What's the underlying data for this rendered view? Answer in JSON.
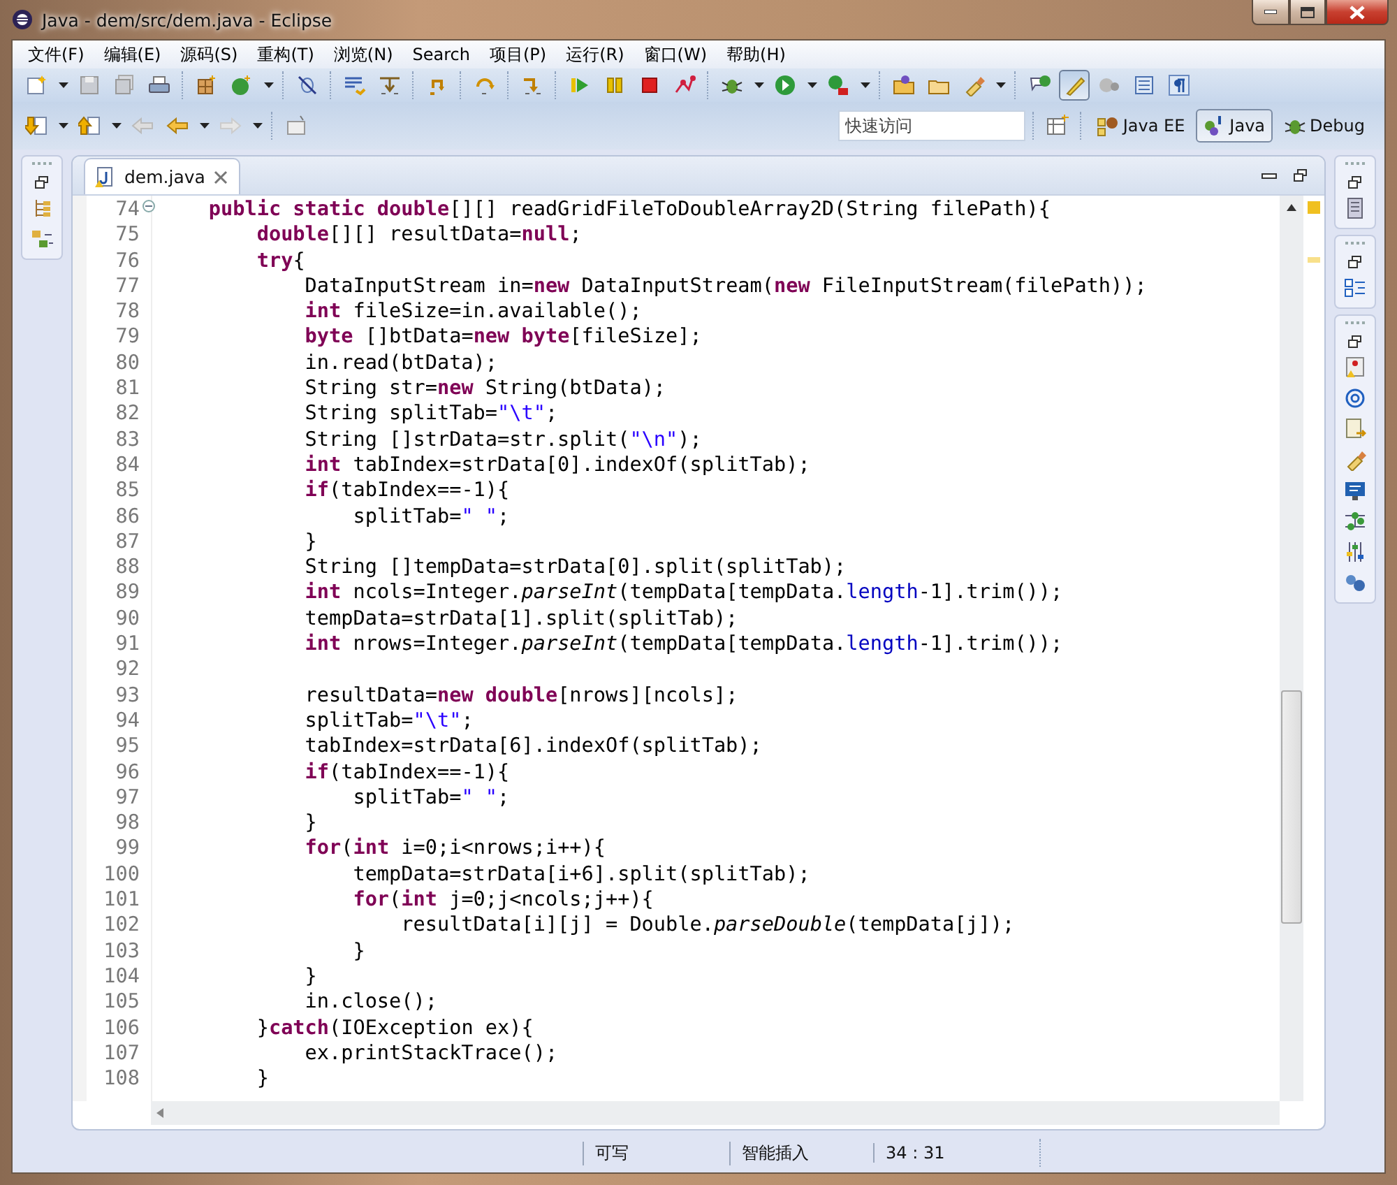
{
  "window": {
    "title": "Java - dem/src/dem.java - Eclipse"
  },
  "menu": [
    "文件(F)",
    "编辑(E)",
    "源码(S)",
    "重构(T)",
    "浏览(N)",
    "Search",
    "项目(P)",
    "运行(R)",
    "窗口(W)",
    "帮助(H)"
  ],
  "toolbar": {
    "mark_occurrences_pressed": true
  },
  "quick_access": {
    "placeholder": "快速访问"
  },
  "perspectives": [
    {
      "label": "Java EE",
      "selected": false
    },
    {
      "label": "Java",
      "selected": true
    },
    {
      "label": "Debug",
      "selected": false
    }
  ],
  "editor_tabs": [
    {
      "label": "dem.java",
      "selected": true
    }
  ],
  "code": {
    "lines": [
      {
        "number": "74",
        "folding": true,
        "tokens": [
          {
            "kind": "keyword",
            "text": "    public static double"
          },
          {
            "kind": "plain",
            "text": "[][] readGridFileToDoubleArray2D(String filePath){"
          }
        ]
      },
      {
        "number": "75",
        "tokens": [
          {
            "kind": "keyword",
            "text": "        double"
          },
          {
            "kind": "plain",
            "text": "[][] resultData="
          },
          {
            "kind": "keyword",
            "text": "null"
          },
          {
            "kind": "plain",
            "text": ";"
          }
        ]
      },
      {
        "number": "76",
        "tokens": [
          {
            "kind": "keyword",
            "text": "        try"
          },
          {
            "kind": "plain",
            "text": "{"
          }
        ]
      },
      {
        "number": "77",
        "tokens": [
          {
            "kind": "plain",
            "text": "            DataInputStream in="
          },
          {
            "kind": "keyword",
            "text": "new"
          },
          {
            "kind": "plain",
            "text": " DataInputStream("
          },
          {
            "kind": "keyword",
            "text": "new"
          },
          {
            "kind": "plain",
            "text": " FileInputStream(filePath));"
          }
        ]
      },
      {
        "number": "78",
        "tokens": [
          {
            "kind": "keyword",
            "text": "            int"
          },
          {
            "kind": "plain",
            "text": " fileSize=in.available();"
          }
        ]
      },
      {
        "number": "79",
        "tokens": [
          {
            "kind": "keyword",
            "text": "            byte"
          },
          {
            "kind": "plain",
            "text": " []btData="
          },
          {
            "kind": "keyword",
            "text": "new byte"
          },
          {
            "kind": "plain",
            "text": "[fileSize];"
          }
        ]
      },
      {
        "number": "80",
        "tokens": [
          {
            "kind": "plain",
            "text": "            in.read(btData);"
          }
        ]
      },
      {
        "number": "81",
        "tokens": [
          {
            "kind": "plain",
            "text": "            String str="
          },
          {
            "kind": "keyword",
            "text": "new"
          },
          {
            "kind": "plain",
            "text": " String(btData);"
          }
        ]
      },
      {
        "number": "82",
        "tokens": [
          {
            "kind": "plain",
            "text": "            String splitTab="
          },
          {
            "kind": "string",
            "text": "\"\\t\""
          },
          {
            "kind": "plain",
            "text": ";"
          }
        ]
      },
      {
        "number": "83",
        "tokens": [
          {
            "kind": "plain",
            "text": "            String []strData=str.split("
          },
          {
            "kind": "string",
            "text": "\"\\n\""
          },
          {
            "kind": "plain",
            "text": ");"
          }
        ]
      },
      {
        "number": "84",
        "tokens": [
          {
            "kind": "keyword",
            "text": "            int"
          },
          {
            "kind": "plain",
            "text": " tabIndex=strData[0].indexOf(splitTab);"
          }
        ]
      },
      {
        "number": "85",
        "tokens": [
          {
            "kind": "keyword",
            "text": "            if"
          },
          {
            "kind": "plain",
            "text": "(tabIndex==-1){"
          }
        ]
      },
      {
        "number": "86",
        "tokens": [
          {
            "kind": "plain",
            "text": "                splitTab="
          },
          {
            "kind": "string",
            "text": "\" \""
          },
          {
            "kind": "plain",
            "text": ";"
          }
        ]
      },
      {
        "number": "87",
        "tokens": [
          {
            "kind": "plain",
            "text": "            }"
          }
        ]
      },
      {
        "number": "88",
        "tokens": [
          {
            "kind": "plain",
            "text": "            String []tempData=strData[0].split(splitTab);"
          }
        ]
      },
      {
        "number": "89",
        "tokens": [
          {
            "kind": "keyword",
            "text": "            int"
          },
          {
            "kind": "plain",
            "text": " ncols=Integer."
          },
          {
            "kind": "static",
            "text": "parseInt"
          },
          {
            "kind": "plain",
            "text": "(tempData[tempData."
          },
          {
            "kind": "field",
            "text": "length"
          },
          {
            "kind": "plain",
            "text": "-1].trim());"
          }
        ]
      },
      {
        "number": "90",
        "tokens": [
          {
            "kind": "plain",
            "text": "            tempData=strData[1].split(splitTab);"
          }
        ]
      },
      {
        "number": "91",
        "tokens": [
          {
            "kind": "keyword",
            "text": "            int"
          },
          {
            "kind": "plain",
            "text": " nrows=Integer."
          },
          {
            "kind": "static",
            "text": "parseInt"
          },
          {
            "kind": "plain",
            "text": "(tempData[tempData."
          },
          {
            "kind": "field",
            "text": "length"
          },
          {
            "kind": "plain",
            "text": "-1].trim());"
          }
        ]
      },
      {
        "number": "92"
      },
      {
        "number": "93",
        "tokens": [
          {
            "kind": "plain",
            "text": "            resultData="
          },
          {
            "kind": "keyword",
            "text": "new double"
          },
          {
            "kind": "plain",
            "text": "[nrows][ncols];"
          }
        ]
      },
      {
        "number": "94",
        "tokens": [
          {
            "kind": "plain",
            "text": "            splitTab="
          },
          {
            "kind": "string",
            "text": "\"\\t\""
          },
          {
            "kind": "plain",
            "text": ";"
          }
        ]
      },
      {
        "number": "95",
        "tokens": [
          {
            "kind": "plain",
            "text": "            tabIndex=strData[6].indexOf(splitTab);"
          }
        ]
      },
      {
        "number": "96",
        "tokens": [
          {
            "kind": "keyword",
            "text": "            if"
          },
          {
            "kind": "plain",
            "text": "(tabIndex==-1){"
          }
        ]
      },
      {
        "number": "97",
        "tokens": [
          {
            "kind": "plain",
            "text": "                splitTab="
          },
          {
            "kind": "string",
            "text": "\" \""
          },
          {
            "kind": "plain",
            "text": ";"
          }
        ]
      },
      {
        "number": "98",
        "tokens": [
          {
            "kind": "plain",
            "text": "            }"
          }
        ]
      },
      {
        "number": "99",
        "tokens": [
          {
            "kind": "keyword",
            "text": "            for"
          },
          {
            "kind": "plain",
            "text": "("
          },
          {
            "kind": "keyword",
            "text": "int"
          },
          {
            "kind": "plain",
            "text": " i=0;i<nrows;i++){"
          }
        ]
      },
      {
        "number": "100",
        "tokens": [
          {
            "kind": "plain",
            "text": "                tempData=strData[i+6].split(splitTab);"
          }
        ]
      },
      {
        "number": "101",
        "tokens": [
          {
            "kind": "keyword",
            "text": "                for"
          },
          {
            "kind": "plain",
            "text": "("
          },
          {
            "kind": "keyword",
            "text": "int"
          },
          {
            "kind": "plain",
            "text": " j=0;j<ncols;j++){"
          }
        ]
      },
      {
        "number": "102",
        "tokens": [
          {
            "kind": "plain",
            "text": "                    resultData[i][j] = Double."
          },
          {
            "kind": "static",
            "text": "parseDouble"
          },
          {
            "kind": "plain",
            "text": "(tempData[j]);"
          }
        ]
      },
      {
        "number": "103",
        "tokens": [
          {
            "kind": "plain",
            "text": "                }"
          }
        ]
      },
      {
        "number": "104",
        "tokens": [
          {
            "kind": "plain",
            "text": "            }"
          }
        ]
      },
      {
        "number": "105",
        "tokens": [
          {
            "kind": "plain",
            "text": "            in.close();"
          }
        ]
      },
      {
        "number": "106",
        "tokens": [
          {
            "kind": "plain",
            "text": "        }"
          },
          {
            "kind": "keyword",
            "text": "catch"
          },
          {
            "kind": "plain",
            "text": "(IOException ex){"
          }
        ]
      },
      {
        "number": "107",
        "tokens": [
          {
            "kind": "plain",
            "text": "            ex.printStackTrace();"
          }
        ]
      },
      {
        "number": "108",
        "tokens": [
          {
            "kind": "plain",
            "text": "        }"
          }
        ]
      }
    ]
  },
  "status_bar": [
    "可写",
    "智能插入",
    "34 : 31"
  ]
}
